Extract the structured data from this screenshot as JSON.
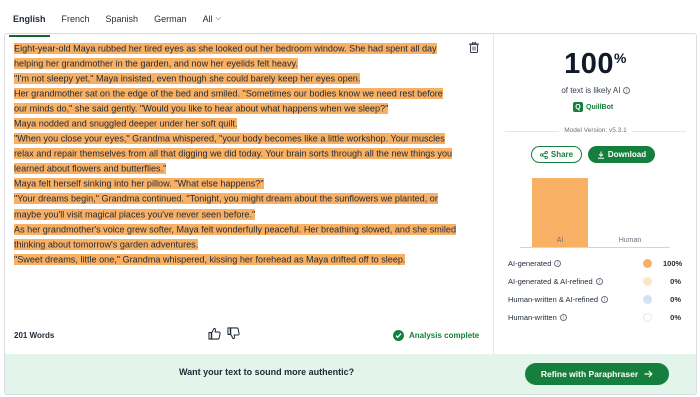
{
  "tabs": [
    {
      "label": "English",
      "active": true
    },
    {
      "label": "French",
      "active": false
    },
    {
      "label": "Spanish",
      "active": false
    },
    {
      "label": "German",
      "active": false
    },
    {
      "label": "All",
      "active": false
    }
  ],
  "editor": {
    "lines": [
      "Eight-year-old Maya rubbed her tired eyes as she looked out her bedroom window. She had spent all day",
      "helping her grandmother in the garden, and now her eyelids felt heavy.",
      "\"I'm not sleepy yet,\" Maya insisted, even though she could barely keep her eyes open.",
      "Her grandmother sat on the edge of the bed and smiled. \"Sometimes our bodies know we need rest before",
      "our minds do,\" she said gently. \"Would you like to hear about what happens when we sleep?\"",
      "Maya nodded and snuggled deeper under her soft quilt.",
      "\"When you close your eyes,\" Grandma whispered, \"your body becomes like a little workshop. Your muscles",
      "relax and repair themselves from all that digging we did today. Your brain sorts through all the new things you",
      "learned about flowers and butterflies.\"",
      "Maya felt herself sinking into her pillow. \"What else happens?\"",
      "\"Your dreams begin,\" Grandma continued. \"Tonight, you might dream about the sunflowers we planted, or",
      "maybe you'll visit magical places you've never seen before.\"",
      "As her grandmother's voice grew softer, Maya felt wonderfully peaceful. Her breathing slowed, and she smiled",
      "thinking about tomorrow's garden adventures.",
      "\"Sweet dreams, little one,\" Grandma whispered, kissing her forehead as Maya drifted off to sleep."
    ],
    "word_count": "201 Words",
    "status": "Analysis complete",
    "highlight_color": "#f8b064"
  },
  "result": {
    "percent": "100",
    "percent_sign": "%",
    "likely_label": "of text is likely AI",
    "brand": "QuillBot",
    "model_version": "Model Version: v5.3.1",
    "share_label": "Share",
    "download_label": "Download"
  },
  "chart_data": {
    "type": "bar",
    "categories": [
      "AI",
      "Human"
    ],
    "values": [
      100,
      0
    ],
    "colors": [
      "#f8b064",
      "#c7d2fe"
    ],
    "ylim": [
      0,
      100
    ],
    "grid": false
  },
  "legend": [
    {
      "label": "AI-generated",
      "value": "100%",
      "color": "#f8b064",
      "info": true
    },
    {
      "label": "AI-generated & AI-refined",
      "value": "0%",
      "color": "#fde5c8",
      "info": true
    },
    {
      "label": "Human-written & AI-refined",
      "value": "0%",
      "color": "#d6e0f5",
      "info": true
    },
    {
      "label": "Human-written",
      "value": "0%",
      "color": "#ffffff",
      "info": true
    }
  ],
  "footer": {
    "prompt": "Want your text to sound more authentic?",
    "cta": "Refine with Paraphraser"
  },
  "colors": {
    "brand_green": "#15803d",
    "footer_bg": "#e3f4ea"
  }
}
